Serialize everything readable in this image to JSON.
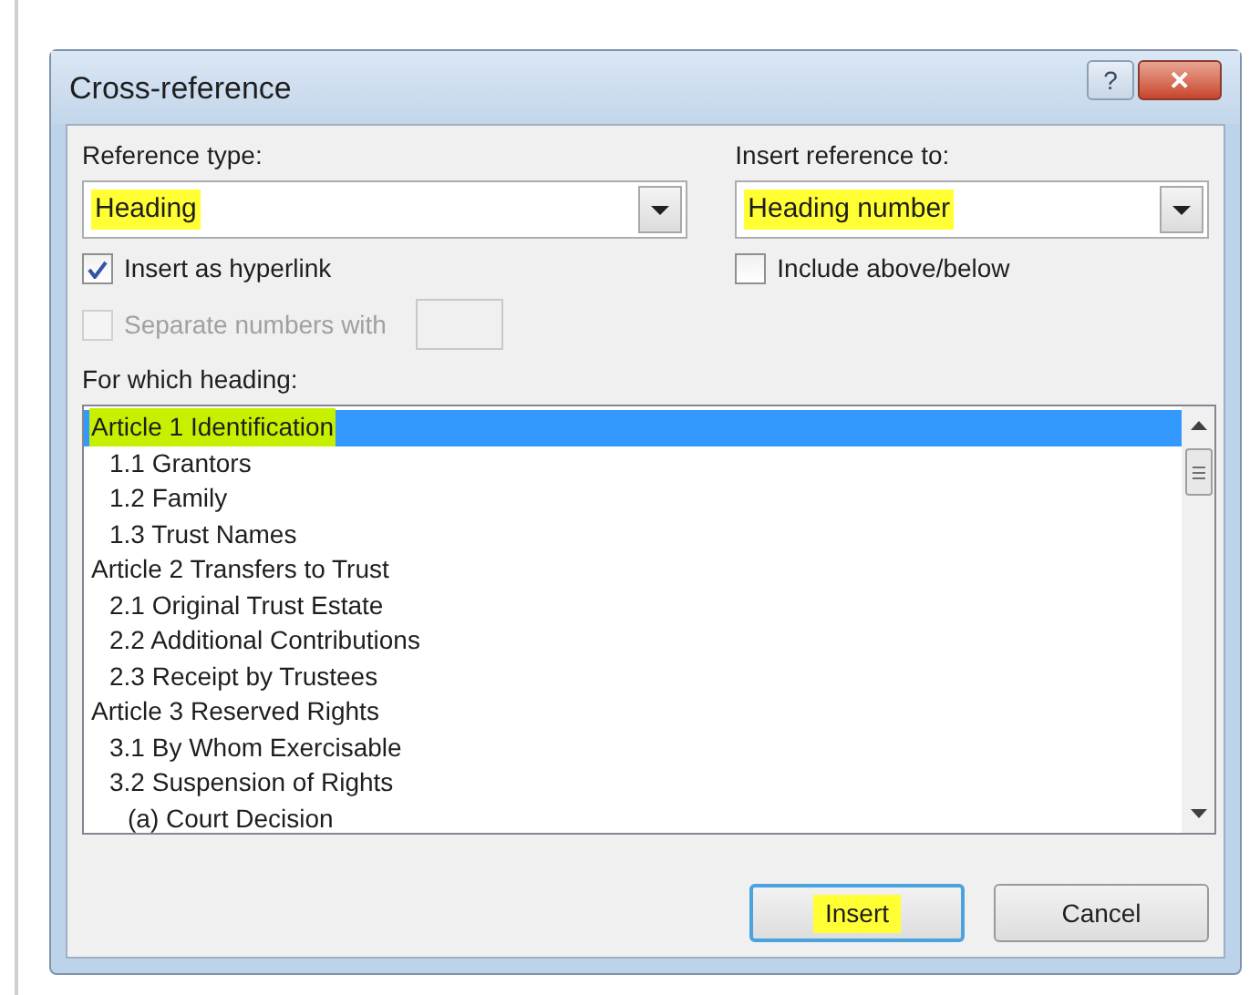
{
  "window": {
    "title": "Cross-reference",
    "buttons": [
      {
        "kind": "help",
        "label": "?"
      },
      {
        "kind": "close",
        "label": "✕"
      }
    ]
  },
  "reference_type": {
    "label": "Reference type:",
    "value": "Heading",
    "highlighted": true
  },
  "insert_reference_to": {
    "label": "Insert reference to:",
    "value": "Heading number",
    "highlighted": true
  },
  "insert_as_hyperlink": {
    "label": "Insert as hyperlink",
    "checked": true,
    "disabled": false
  },
  "include_above_below": {
    "label": "Include above/below",
    "checked": false,
    "disabled": false
  },
  "separate_numbers": {
    "label": "Separate numbers with",
    "checked": false,
    "disabled": true
  },
  "heading_list": {
    "label": "For which heading:",
    "items": [
      {
        "text": "Article 1 Identification",
        "selected": true,
        "highlighted": true,
        "children": [
          {
            "text": "1.1 Grantors",
            "selected": false
          },
          {
            "text": "1.2 Family",
            "selected": false
          },
          {
            "text": "1.3 Trust Names",
            "selected": false
          }
        ]
      },
      {
        "text": "Article 2 Transfers to Trust",
        "selected": false,
        "children": [
          {
            "text": "2.1 Original Trust Estate",
            "selected": false
          },
          {
            "text": "2.2 Additional Contributions",
            "selected": false
          },
          {
            "text": "2.3 Receipt by Trustees",
            "selected": false
          }
        ]
      },
      {
        "text": "Article 3 Reserved Rights",
        "selected": false,
        "children": [
          {
            "text": "3.1 By Whom Exercisable",
            "selected": false
          },
          {
            "text": "3.2 Suspension of Rights",
            "selected": false,
            "children": [
              {
                "text": "(a) Court Decision",
                "selected": false
              }
            ]
          }
        ]
      }
    ]
  },
  "buttons": [
    {
      "label": "Insert",
      "default": true,
      "highlighted": true
    },
    {
      "label": "Cancel",
      "default": false
    }
  ]
}
